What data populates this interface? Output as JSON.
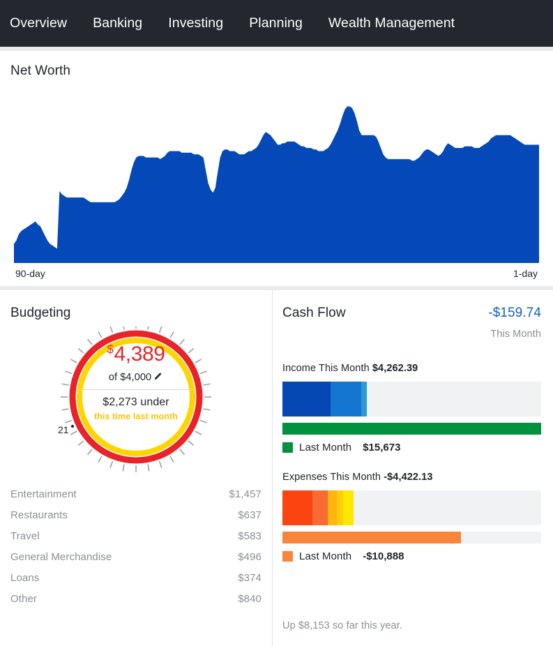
{
  "nav": {
    "items": [
      {
        "label": "Overview"
      },
      {
        "label": "Banking"
      },
      {
        "label": "Investing"
      },
      {
        "label": "Planning"
      },
      {
        "label": "Wealth Management"
      }
    ]
  },
  "net_worth": {
    "title": "Net Worth",
    "axis_left": "90-day",
    "axis_right": "1-day",
    "area_color": "#0548b8"
  },
  "budgeting": {
    "title": "Budgeting",
    "gauge": {
      "dollar_sign": "$",
      "amount": "4,389",
      "of_label": "of $4,000",
      "pencil_icon": "pencil-icon",
      "under_label": "$2,273 under",
      "sub_label": "this time last month",
      "tick_label": "21",
      "outer_ring_color": "#e8242a",
      "inner_ring_color": "#ffd500",
      "amount_color": "#e8242a",
      "sub_color": "#fdc500"
    },
    "categories": [
      {
        "name": "Entertainment",
        "value": "$1,457"
      },
      {
        "name": "Restaurants",
        "value": "$637"
      },
      {
        "name": "Travel",
        "value": "$583"
      },
      {
        "name": "General Merchandise",
        "value": "$496"
      },
      {
        "name": "Loans",
        "value": "$374"
      },
      {
        "name": "Other",
        "value": "$840"
      }
    ]
  },
  "cash_flow": {
    "title": "Cash Flow",
    "net_amount": "-$159.74",
    "net_period": "This Month",
    "net_color": "#1060c9",
    "income": {
      "label": "Income This Month",
      "amount": "$4,262.39",
      "segments": [
        {
          "color": "#0648b3",
          "pct": 18.5
        },
        {
          "color": "#1476d1",
          "pct": 12.0
        },
        {
          "color": "#2b9ad9",
          "pct": 2.0
        }
      ],
      "last_month_label": "Last Month",
      "last_month_value": "$15,673",
      "last_month_color": "#00923f",
      "last_month_pct": 100
    },
    "expenses": {
      "label": "Expenses This Month",
      "amount": "-$4,422.13",
      "segments": [
        {
          "color": "#fc4411",
          "pct": 11.5
        },
        {
          "color": "#fa6a33",
          "pct": 6.0
        },
        {
          "color": "#ffb412",
          "pct": 3.5
        },
        {
          "color": "#ffcd0a",
          "pct": 2.5
        },
        {
          "color": "#ffe800",
          "pct": 4.0
        }
      ],
      "last_month_label": "Last Month",
      "last_month_value": "-$10,888",
      "last_month_color": "#f7863c",
      "last_month_pct": 69
    },
    "footer": "Up $8,153 so far this year."
  },
  "chart_data": {
    "type": "area",
    "title": "Net Worth",
    "xlabel": "",
    "ylabel": "",
    "x_tick_labels": [
      "90-day",
      "1-day"
    ],
    "grid": false,
    "legend": false,
    "series": [
      {
        "name": "Net Worth",
        "color": "#0548b8",
        "values": [
          12,
          14,
          18,
          20,
          21,
          22,
          23,
          24,
          25,
          26,
          24,
          23,
          20,
          17,
          14,
          12,
          11,
          10,
          9,
          45,
          43,
          42,
          41,
          41,
          41,
          41,
          41,
          41,
          41,
          41,
          40,
          39,
          38,
          38,
          38,
          38,
          38,
          38,
          38,
          38,
          38,
          38,
          38,
          39,
          40,
          42,
          44,
          47,
          52,
          58,
          63,
          66,
          67,
          67,
          67,
          66,
          66,
          66,
          66,
          66,
          66,
          65,
          66,
          67,
          69,
          70,
          70,
          70,
          70,
          70,
          69,
          69,
          69,
          69,
          69,
          68,
          68,
          68,
          67,
          66,
          58,
          50,
          46,
          44,
          47,
          57,
          66,
          70,
          71,
          71,
          70,
          70,
          70,
          69,
          68,
          68,
          68,
          69,
          70,
          70,
          71,
          72,
          74,
          77,
          80,
          82,
          81,
          80,
          78,
          76,
          74,
          74,
          75,
          75,
          76,
          76,
          76,
          76,
          75,
          74,
          73,
          73,
          72,
          72,
          72,
          71,
          71,
          70,
          70,
          70,
          71,
          72,
          74,
          77,
          80,
          83,
          87,
          92,
          96,
          98,
          98,
          97,
          94,
          89,
          83,
          80,
          80,
          80,
          80,
          80,
          80,
          79,
          76,
          72,
          68,
          66,
          65,
          65,
          65,
          65,
          65,
          65,
          65,
          65,
          65,
          65,
          64,
          64,
          65,
          66,
          68,
          70,
          71,
          71,
          70,
          69,
          68,
          67,
          68,
          70,
          73,
          75,
          74,
          73,
          72,
          72,
          72,
          72,
          73,
          73,
          73,
          73,
          72,
          72,
          72,
          73,
          74,
          75,
          76,
          78,
          79,
          80,
          80,
          80,
          80,
          80,
          80,
          80,
          79,
          78,
          77,
          76,
          75,
          74,
          74,
          74,
          74,
          74,
          74,
          74
        ]
      }
    ],
    "ylim": [
      0,
      110
    ],
    "fill": true
  }
}
